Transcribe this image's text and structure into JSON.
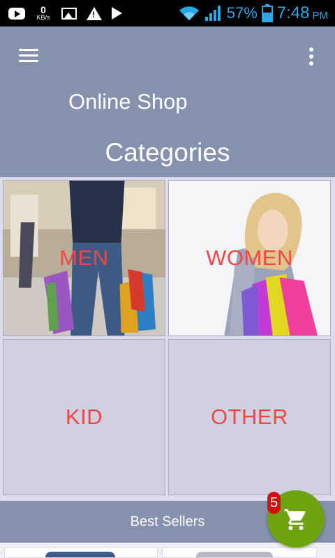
{
  "status_bar": {
    "kb_value": "0",
    "kb_unit": "KB/s",
    "battery": "57%",
    "time": "7:48",
    "ampm": "PM",
    "accent": "#2aa8e6"
  },
  "app_bar": {
    "title": "Online Shop",
    "subtitle": "Categories",
    "menu_icon": "hamburger-menu-icon",
    "overflow_icon": "more-vertical-icon",
    "color": "#8591ad"
  },
  "categories": [
    {
      "label": "MEN"
    },
    {
      "label": "WOMEN"
    },
    {
      "label": "KID"
    },
    {
      "label": "OTHER"
    }
  ],
  "best_sellers": {
    "label": "Best Sellers"
  },
  "cart": {
    "count": "5",
    "icon": "shopping-cart-icon",
    "color": "#6ea30f",
    "badge_color": "#d31010"
  },
  "label_color": "#ef4747"
}
